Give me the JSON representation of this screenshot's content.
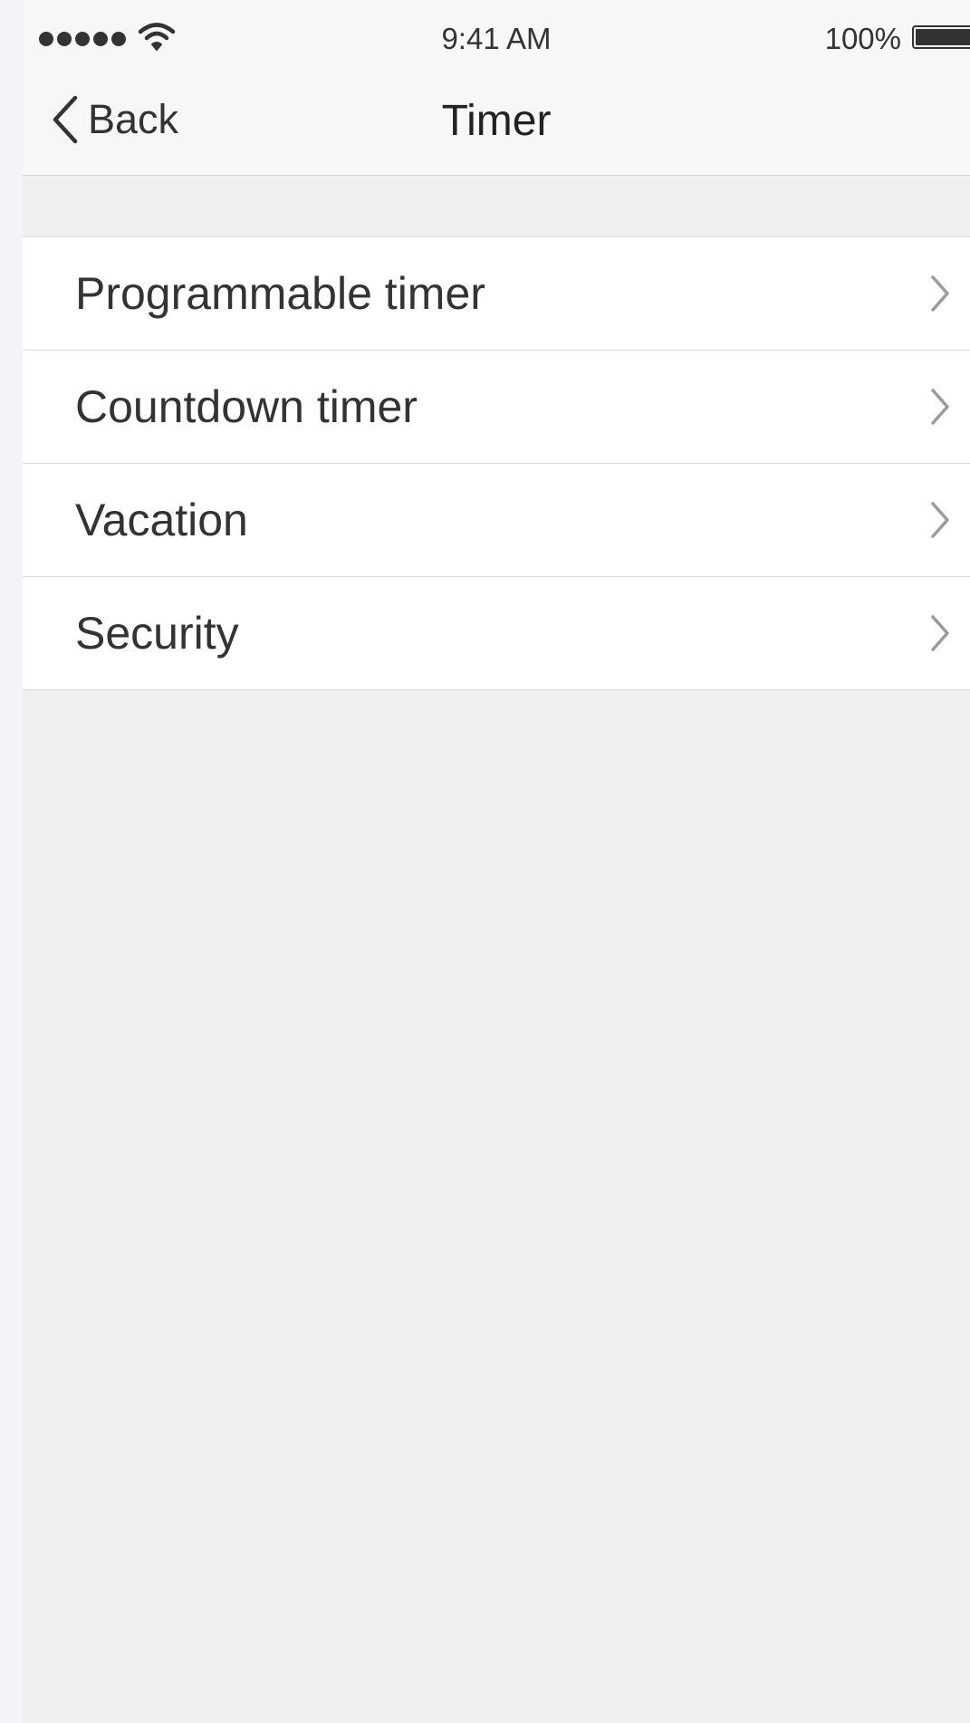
{
  "status_bar": {
    "time": "9:41 AM",
    "battery_percent": "100%",
    "signal_icon": "signal-dots-icon",
    "wifi_icon": "wifi-icon",
    "battery_icon": "battery-icon"
  },
  "nav": {
    "back_label": "Back",
    "back_icon": "chevron-left-icon",
    "title": "Timer"
  },
  "menu": {
    "items": [
      {
        "label": "Programmable timer",
        "icon": "chevron-right-icon"
      },
      {
        "label": "Countdown timer",
        "icon": "chevron-right-icon"
      },
      {
        "label": "Vacation",
        "icon": "chevron-right-icon"
      },
      {
        "label": "Security",
        "icon": "chevron-right-icon"
      }
    ]
  },
  "colors": {
    "background": "#efeff0",
    "header": "#f7f7f7",
    "list_background": "#ffffff",
    "text": "#333333",
    "chevron": "#9a9a9a",
    "divider": "#dcdcdc"
  }
}
